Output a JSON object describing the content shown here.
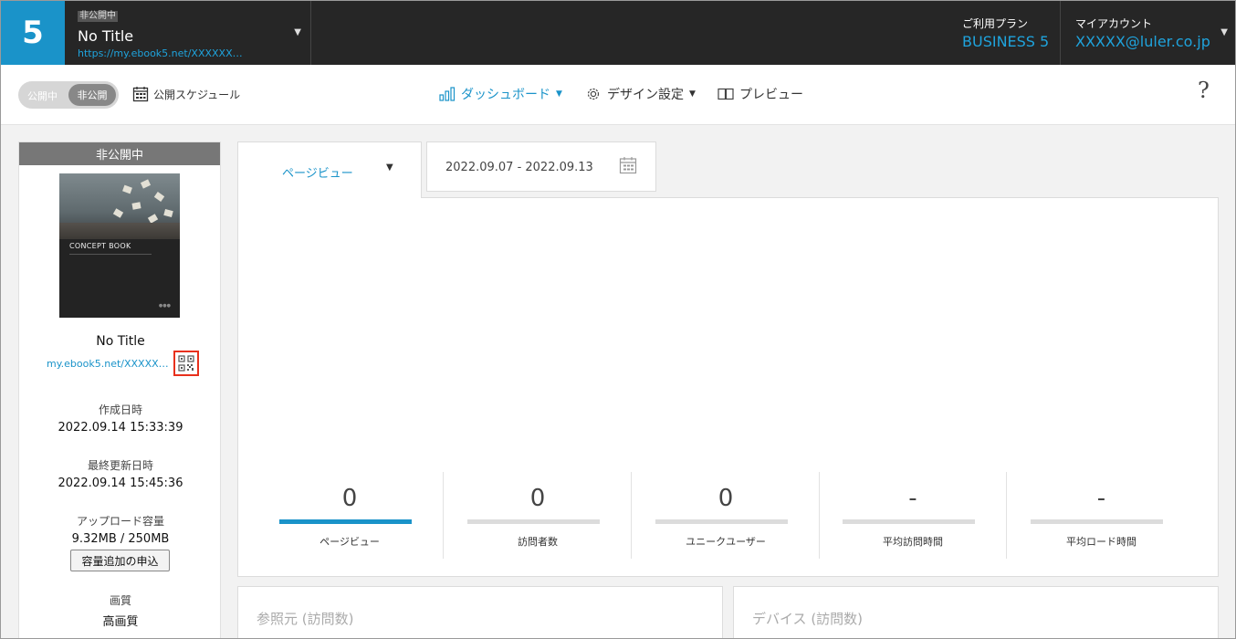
{
  "header": {
    "logo": "5",
    "book": {
      "status": "非公開中",
      "title": "No Title",
      "url": "https://my.ebook5.net/XXXXXX…"
    },
    "plan": {
      "label": "ご利用プラン",
      "value": "BUSINESS 5"
    },
    "account": {
      "label": "マイアカウント",
      "value": "XXXXX@luler.co.jp"
    }
  },
  "toolbar": {
    "publish_toggle": {
      "on_label": "公開中",
      "off_label": "非公開",
      "state": "非公開"
    },
    "schedule_label": "公開スケジュール",
    "nav": {
      "dashboard": "ダッシュボード",
      "design": "デザイン設定",
      "preview": "プレビュー"
    },
    "help": "?"
  },
  "sidebar": {
    "status_header": "非公開中",
    "cover_text": "CONCEPT BOOK",
    "title": "No Title",
    "url": "my.ebook5.net/XXXXX…",
    "created_label": "作成日時",
    "created_value": "2022.09.14 15:33:39",
    "updated_label": "最終更新日時",
    "updated_value": "2022.09.14 15:45:36",
    "upload_label": "アップロード容量",
    "upload_value": "9.32MB / 250MB",
    "add_capacity_button": "容量追加の申込",
    "quality_label": "画質",
    "quality_value": "高画質"
  },
  "analytics": {
    "metric_select": "ページビュー",
    "date_range": "2022.09.07 - 2022.09.13",
    "stats": [
      {
        "value": "0",
        "label": "ページビュー",
        "active": true
      },
      {
        "value": "0",
        "label": "訪問者数",
        "active": false
      },
      {
        "value": "0",
        "label": "ユニークユーザー",
        "active": false
      },
      {
        "value": "-",
        "label": "平均訪問時間",
        "active": false
      },
      {
        "value": "-",
        "label": "平均ロード時間",
        "active": false
      }
    ],
    "referrer_title": "参照元 (訪問数)",
    "device_title": "デバイス (訪問数)"
  },
  "colors": {
    "accent": "#1a93c9",
    "topbar": "#262626",
    "highlight": "#e8301c"
  }
}
